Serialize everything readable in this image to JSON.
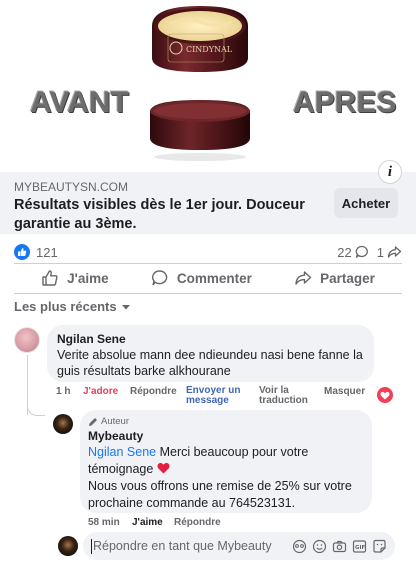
{
  "ad": {
    "word_before": "AVANT",
    "word_after": "APRES",
    "jar_label": "CINDYNAL",
    "info_icon": "i",
    "domain": "MYBEAUTYSN.COM",
    "headline": "Résultats visibles dès le 1er jour. Douceur garantie au 3ème.",
    "cta_label": "Acheter"
  },
  "stats": {
    "reaction_count": "121",
    "comments_count": "22",
    "shares_count": "1"
  },
  "actions": {
    "like": "J'aime",
    "comment": "Commenter",
    "share": "Partager"
  },
  "sort_label": "Les plus récents",
  "comment": {
    "author": "Ngilan Sene",
    "text": "Verite absolue mann dee ndieundeu nasi bene fanne la guis résultats barke alkhourane",
    "time": "1 h",
    "reaction_label": "J'adore",
    "reply": "Répondre",
    "send_message": "Envoyer un message",
    "see_translation": "Voir la traduction",
    "hide": "Masquer"
  },
  "reply": {
    "badge": "Auteur",
    "author": "Mybeauty",
    "mention": "Ngilan Sene",
    "line1": " Merci beaucoup pour votre témoignage ",
    "line2": "Nous vous offrons une remise de 25% sur votre prochaine commande au 764523131.",
    "time": "58 min",
    "like": "J'aime",
    "reply": "Répondre"
  },
  "composer": {
    "placeholder": "Répondre en tant que Mybeauty"
  },
  "colors": {
    "facebook_blue": "#1877f2",
    "love_red": "#f33e58",
    "bubble_bg": "#f0f2f5",
    "jar_maroon": "#5a1a1e"
  }
}
